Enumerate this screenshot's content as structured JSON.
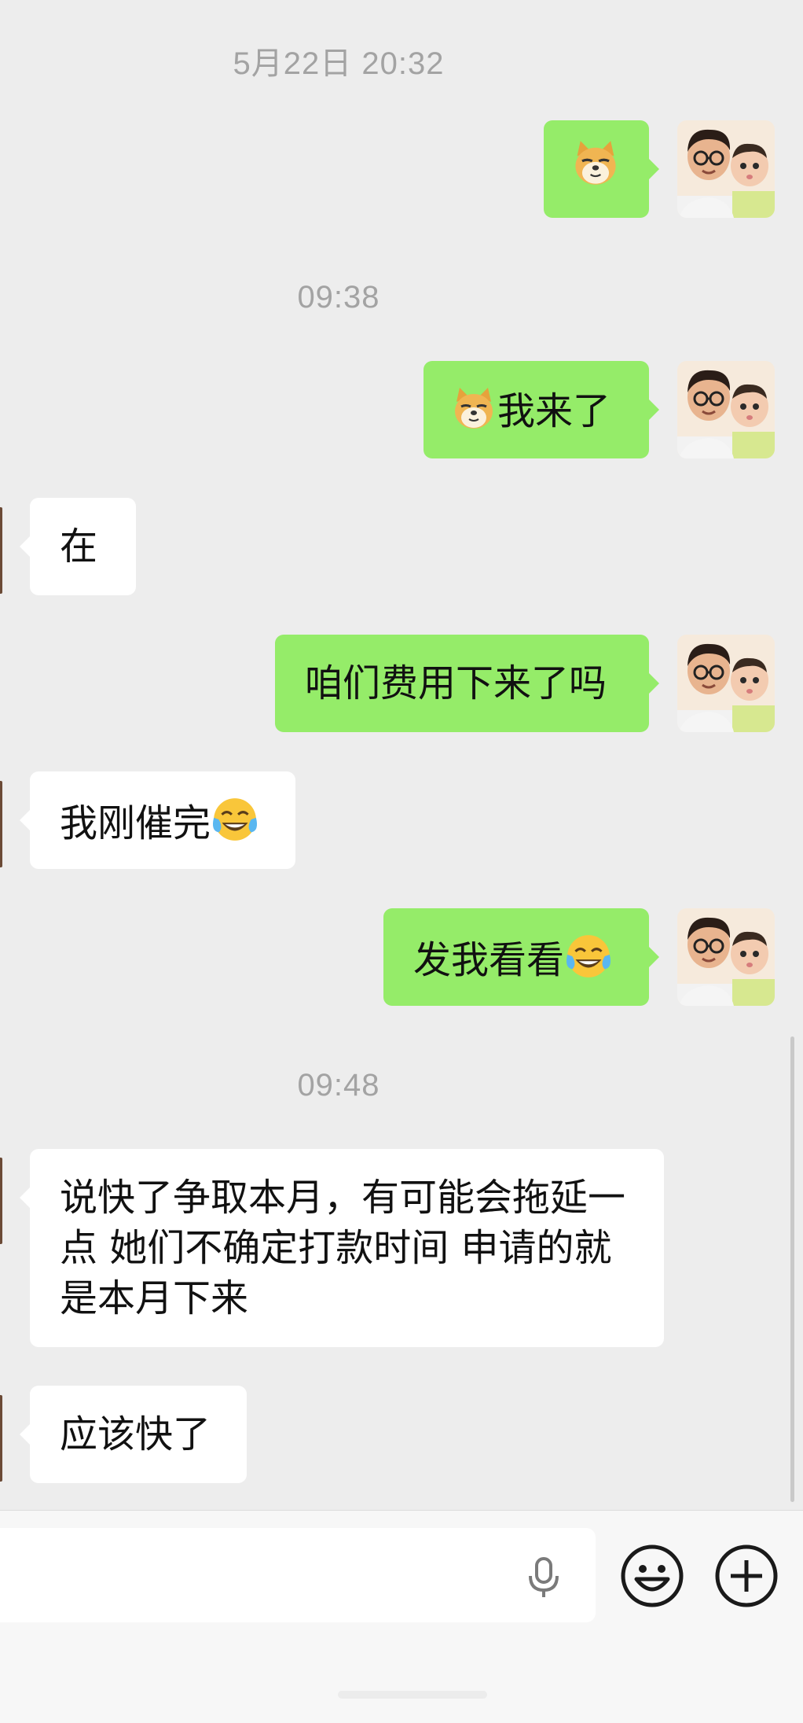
{
  "chat": {
    "timestamps": [
      "5月22日 20:32",
      "09:38",
      "09:48"
    ],
    "messages": [
      {
        "from": "me",
        "text": "",
        "emoji": "doge-emoji"
      },
      {
        "from": "me",
        "text": "我来了",
        "emoji": "doge-emoji"
      },
      {
        "from": "them",
        "text": "在"
      },
      {
        "from": "me",
        "text": "咱们费用下来了吗"
      },
      {
        "from": "them",
        "text": "我刚催完",
        "emoji": "tears-of-joy-emoji"
      },
      {
        "from": "me",
        "text": "发我看看",
        "emoji": "tears-of-joy-emoji"
      },
      {
        "from": "them",
        "text": "说快了争取本月，有可能会拖延一点 她们不确定打款时间 申请的就是本月下来"
      },
      {
        "from": "them",
        "text": "应该快了"
      }
    ]
  },
  "input_bar": {
    "icons": [
      "microphone-icon",
      "emoji-face-icon",
      "plus-icon"
    ]
  },
  "colors": {
    "background": "#ededed",
    "outgoing_bubble": "#95ec69",
    "incoming_bubble": "#ffffff",
    "timestamp": "#a3a3a3"
  }
}
